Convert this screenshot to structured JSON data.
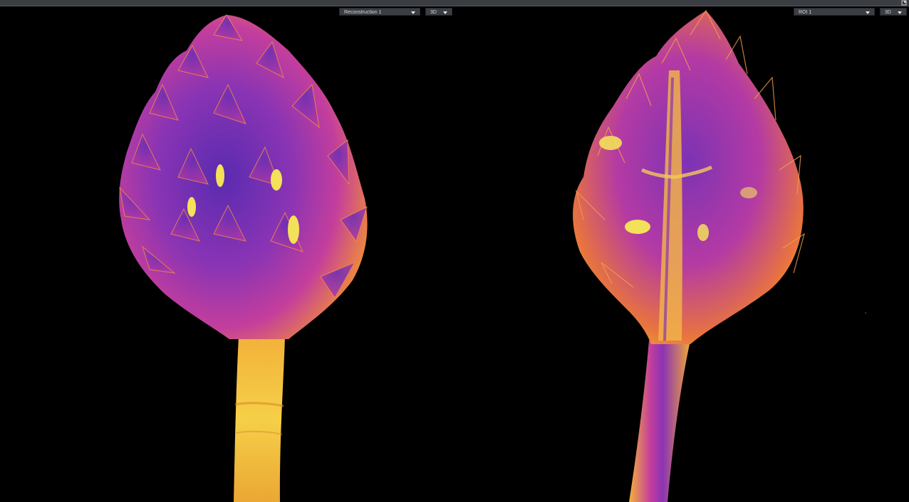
{
  "viewports": {
    "left": {
      "dataset_select": {
        "value": "Reconstruction 1"
      },
      "view_mode_select": {
        "value": "3D"
      },
      "render_name": "volume-render-flower-head"
    },
    "right": {
      "dataset_select": {
        "value": "ROI 1"
      },
      "view_mode_select": {
        "value": "3D"
      },
      "render_name": "volume-render-flower-section"
    }
  },
  "colors": {
    "background": "#000000",
    "toolbar": "#3a3d41",
    "dropdown": "#3b3e43",
    "colormap_low": "#5a2bb0",
    "colormap_mid": "#c43e9c",
    "colormap_high": "#f2d24a"
  },
  "icons": {
    "corner": "maximize-icon",
    "caret": "chevron-down-icon"
  }
}
